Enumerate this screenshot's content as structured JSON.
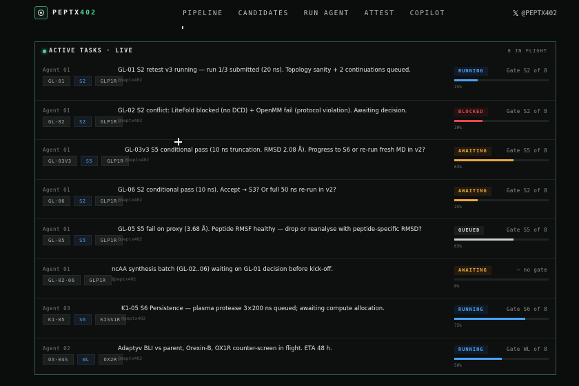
{
  "header": {
    "brand_main": "PEPTX",
    "brand_accent": "402",
    "nav": [
      "PIPELINE",
      "CANDIDATES",
      "RUN AGENT",
      "ATTEST",
      "COPILOT"
    ],
    "social_icon": "x-logo-icon",
    "social_handle": "@PEPTX402"
  },
  "panel": {
    "title": "ACTIVE TASKS · LIVE",
    "count": "8 IN FLIGHT"
  },
  "colors": {
    "accent": "#4fd29b",
    "running": "#4aa3ff",
    "blocked": "#e5484d",
    "awaiting": "#f0a73a",
    "queued": "#cfd4d0"
  },
  "tasks": [
    {
      "agent": "Agent 01",
      "tags": [
        "GL-01",
        "S2",
        "GLP1R"
      ],
      "blue": [
        1
      ],
      "text": "GL-01 S2 retest v3 running — run 1/3 submitted (20 ns). Topology sanity + 2 continuations queued.",
      "handle": "@peptx402",
      "status": "RUNNING",
      "kind": "running",
      "gate": "Gate S2 of 8",
      "progress": 25,
      "pct_label": "25%"
    },
    {
      "agent": "Agent 01",
      "tags": [
        "GL-02",
        "S2",
        "GLP1R"
      ],
      "blue": [
        1
      ],
      "text": "GL-02 S2 conflict: LiteFold blocked (no DCD) + OpenMM fail (protocol violation). Awaiting decision.",
      "handle": "@peptx402",
      "status": "BLOCKED",
      "kind": "blocked",
      "gate": "Gate S2 of 8",
      "progress": 30,
      "pct_label": "30%"
    },
    {
      "agent": "Agent 01",
      "tags": [
        "GL-03V3",
        "S5",
        "GLP1R"
      ],
      "blue": [
        1
      ],
      "text": "GL-03v3 S5 conditional pass (10 ns truncation, RMSD 2.08 Å). Progress to S6 or re-run fresh MD in v2?",
      "handle": "@peptx402",
      "status": "AWAITING",
      "kind": "awaiting",
      "gate": "Gate S5 of 8",
      "progress": 63,
      "pct_label": "63%"
    },
    {
      "agent": "Agent 01",
      "tags": [
        "GL-06",
        "S2",
        "GLP1R"
      ],
      "blue": [
        1
      ],
      "text": "GL-06 S2 conditional pass (10 ns). Accept → S3? Or full 50 ns re-run in v2?",
      "handle": "@peptx402",
      "status": "AWAITING",
      "kind": "awaiting",
      "gate": "Gate S2 of 8",
      "progress": 25,
      "pct_label": "25%"
    },
    {
      "agent": "Agent 01",
      "tags": [
        "GL-05",
        "S5",
        "GLP1R"
      ],
      "blue": [
        1
      ],
      "text": "GL-05 S5 fail on proxy (3.68 Å). Peptide RMSF healthy — drop or reanalyse with peptide-specific RMSD?",
      "handle": "@peptx402",
      "status": "QUEUED",
      "kind": "queued",
      "gate": "Gate S5 of 8",
      "progress": 63,
      "pct_label": "63%"
    },
    {
      "agent": "Agent 01",
      "tags": [
        "GL-02-06",
        "GLP1R"
      ],
      "blue": [],
      "text": "ncAA synthesis batch (GL-02..06) waiting on GL-01 decision before kick-off.",
      "handle": "@peptx402",
      "status": "AWAITING",
      "kind": "awaiting",
      "gate": "— no gate",
      "progress": 0,
      "pct_label": "0%"
    },
    {
      "agent": "Agent 03",
      "tags": [
        "K1-05",
        "S6",
        "KISS1R"
      ],
      "blue": [
        1
      ],
      "text": "K1-05 S6 Persistence — plasma protease 3×200 ns queued; awaiting compute allocation.",
      "handle": "@peptx402",
      "status": "RUNNING",
      "kind": "running",
      "gate": "Gate S6 of 8",
      "progress": 75,
      "pct_label": "75%"
    },
    {
      "agent": "Agent 02",
      "tags": [
        "OX-04S",
        "WL",
        "OX2R"
      ],
      "blue": [
        1
      ],
      "text": "Adaptyv BLI vs parent, Orexin-B, OX1R counter-screen in flight. ETA 48 h.",
      "handle": "@peptx402",
      "status": "RUNNING",
      "kind": "running",
      "gate": "Gate WL of 8",
      "progress": 50,
      "pct_label": "50%"
    }
  ]
}
